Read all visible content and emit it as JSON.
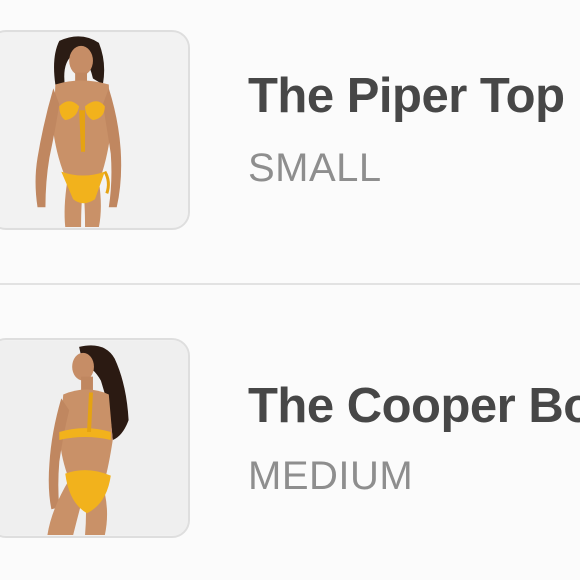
{
  "cart": {
    "items": [
      {
        "title": "The Piper Top",
        "size": "SMALL",
        "thumbnail": "model-yellow-bikini-front"
      },
      {
        "title": "The Cooper Bo",
        "size": "MEDIUM",
        "thumbnail": "model-yellow-bikini-back"
      }
    ]
  },
  "colors": {
    "title_text": "#474747",
    "size_text": "#8e8e8e",
    "divider": "#e2e2e2",
    "thumbnail_border": "#dedede",
    "swimsuit": "#f2b21c",
    "background": "#fbfbfb"
  }
}
